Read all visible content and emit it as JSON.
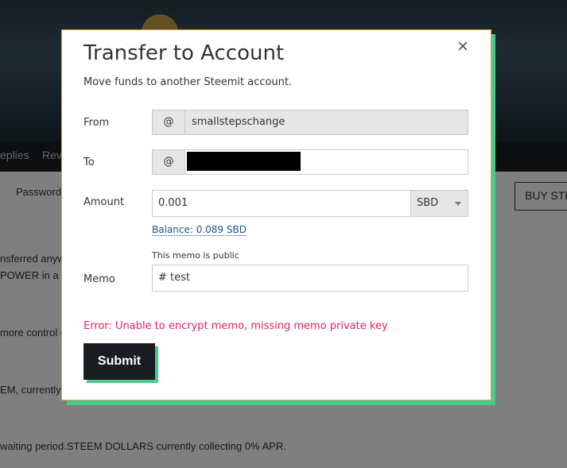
{
  "background": {
    "nav_items": [
      "eplies",
      "Rev"
    ],
    "password_tab": "Password",
    "buy_button": "BUY STE",
    "lines": [
      "nsferred anyw",
      "POWER in a p",
      "more control o",
      "EM, currently c",
      "waiting period.STEEM DOLLARS currently collecting 0% APR."
    ]
  },
  "modal": {
    "title": "Transfer to Account",
    "subtitle": "Move funds to another Steemit account.",
    "close_glyph": "×",
    "from": {
      "label": "From",
      "prefix": "@",
      "value": "smallstepschange"
    },
    "to": {
      "label": "To",
      "prefix": "@",
      "value": ""
    },
    "amount": {
      "label": "Amount",
      "value": "0.001",
      "asset": "SBD"
    },
    "balance_link": "Balance: 0.089 SBD",
    "memo": {
      "label": "Memo",
      "hint": "This memo is public",
      "value": "# test"
    },
    "error": "Error: Unable to encrypt memo, missing memo private key",
    "submit_label": "Submit"
  },
  "colors": {
    "accent": "#4ac98f",
    "error": "#e0245e",
    "link": "#1a5099",
    "dark": "#1a1e23"
  }
}
